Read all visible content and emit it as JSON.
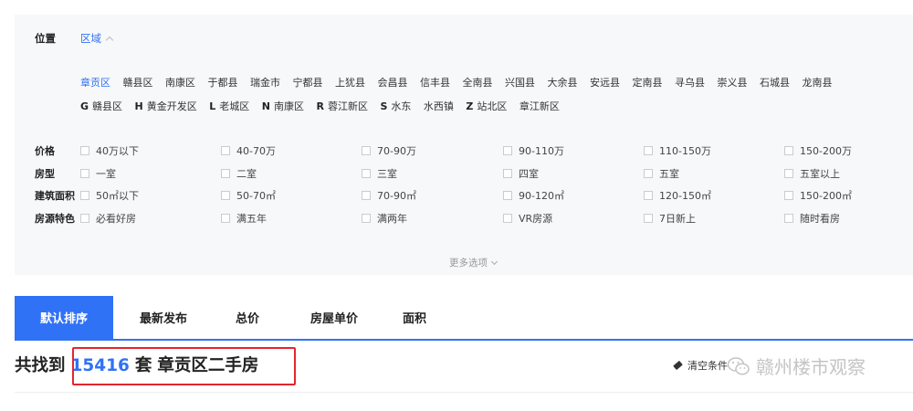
{
  "location": {
    "label": "位置",
    "tab": "区域"
  },
  "districts_row1": [
    "章贡区",
    "赣县区",
    "南康区",
    "于都县",
    "瑞金市",
    "宁都县",
    "上犹县",
    "会昌县",
    "信丰县",
    "全南县",
    "兴国县",
    "大余县",
    "安远县",
    "定南县",
    "寻乌县",
    "崇义县",
    "石城县",
    "龙南县"
  ],
  "districts_row2": [
    {
      "letter": "G",
      "name": "赣县区"
    },
    {
      "letter": "H",
      "name": "黄金开发区"
    },
    {
      "letter": "L",
      "name": "老城区"
    },
    {
      "letter": "N",
      "name": "南康区"
    },
    {
      "letter": "R",
      "name": "蓉江新区"
    },
    {
      "letter": "S",
      "name": "水东"
    },
    {
      "letter": "",
      "name": "水西镇"
    },
    {
      "letter": "Z",
      "name": "站北区"
    },
    {
      "letter": "",
      "name": "章江新区"
    }
  ],
  "filters": [
    {
      "label": "价格",
      "options": [
        "40万以下",
        "40-70万",
        "70-90万",
        "90-110万",
        "110-150万",
        "150-200万"
      ]
    },
    {
      "label": "房型",
      "options": [
        "一室",
        "二室",
        "三室",
        "四室",
        "五室",
        "五室以上"
      ]
    },
    {
      "label": "建筑面积",
      "options": [
        "50㎡以下",
        "50-70㎡",
        "70-90㎡",
        "90-120㎡",
        "120-150㎡",
        "150-200㎡"
      ]
    },
    {
      "label": "房源特色",
      "options": [
        "必看好房",
        "满五年",
        "满两年",
        "VR房源",
        "7日新上",
        "随时看房"
      ]
    }
  ],
  "more_options": "更多选项",
  "sort_tabs": [
    "默认排序",
    "最新发布",
    "总价",
    "房屋单价",
    "面积"
  ],
  "result": {
    "prefix": "共找到",
    "count": "15416",
    "unit": "套",
    "title": "章贡区二手房"
  },
  "clear_label": "清空条件",
  "watermark": "赣州楼市观察",
  "colors": {
    "accent": "#3072f6",
    "highlight_border": "#e3262d",
    "panel_bg": "#f7f8fa"
  }
}
